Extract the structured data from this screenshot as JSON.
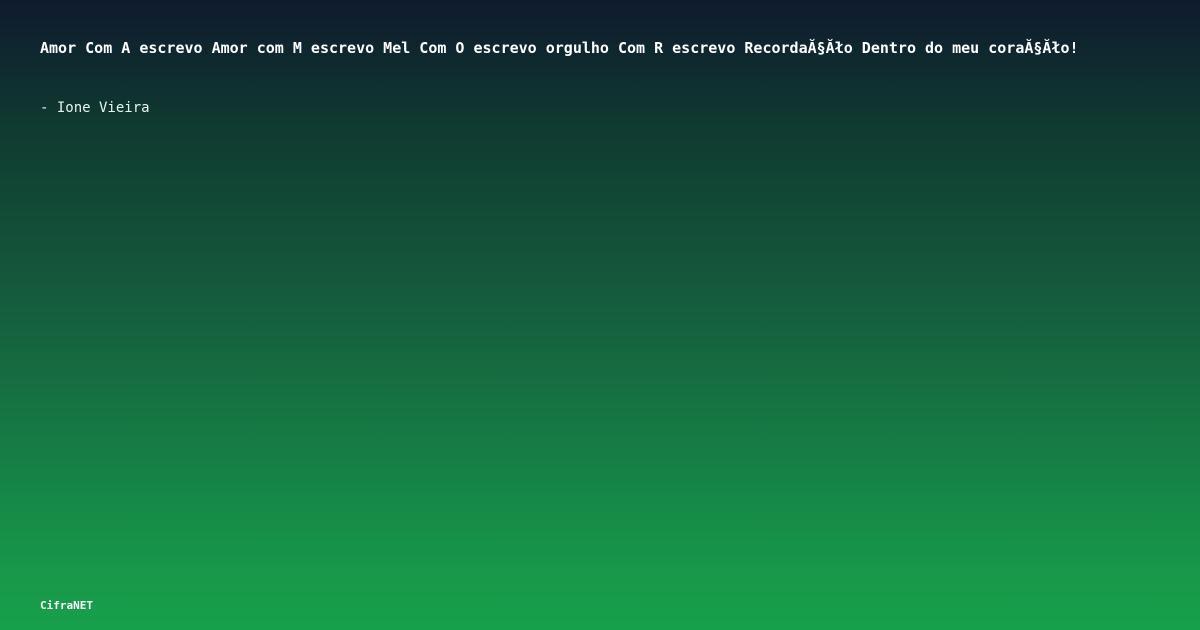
{
  "quote": {
    "text": "Amor Com A escrevo Amor com M escrevo Mel Com O escrevo orgulho Com R escrevo RecordaĂ§Ăło Dentro do meu coraĂ§Ăło!",
    "author": "- Ione Vieira"
  },
  "footer": {
    "brand": "CifraNET"
  },
  "colors": {
    "background_top": "#0f1a2e",
    "background_bottom": "#17a04b",
    "text": "#ffffff"
  }
}
